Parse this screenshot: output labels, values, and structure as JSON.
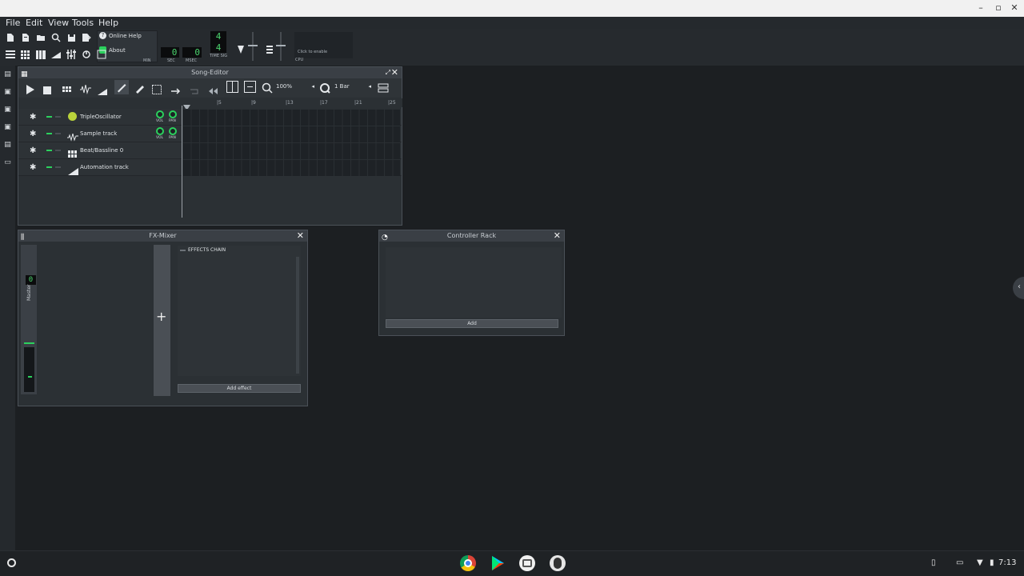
{
  "window": {
    "controls": {
      "minimize": "–",
      "restore": "▫",
      "close": "✕"
    }
  },
  "menu": [
    {
      "label": "File",
      "accel": "F"
    },
    {
      "label": "Edit",
      "accel": "E"
    },
    {
      "label": "View",
      "accel": "V"
    },
    {
      "label": "Tools",
      "accel": "T"
    },
    {
      "label": "Help",
      "accel": "H"
    }
  ],
  "help_menu": {
    "online_help": "Online Help",
    "about": "About"
  },
  "transport": {
    "min": "0",
    "sec": "0",
    "msec": "0",
    "min_label": "MIN",
    "sec_label": "SEC",
    "msec_label": "MSEC",
    "timesig_num": "4",
    "timesig_den": "4",
    "timesig_label": "TIME SIG",
    "cpu_hint": "Click to enable",
    "cpu_label": "CPU"
  },
  "song_editor": {
    "title": "Song-Editor",
    "zoom": "100%",
    "snap": "1 Bar",
    "ruler": [
      "5",
      "9",
      "13",
      "17",
      "21",
      "25"
    ],
    "tracks": [
      {
        "name": "TripleOscillator",
        "icon": "triple-oscillator-icon",
        "knobs": true
      },
      {
        "name": "Sample track",
        "icon": "waveform-icon",
        "knobs": true
      },
      {
        "name": "Beat/Bassline 0",
        "icon": "beat-grid-icon",
        "knobs": false
      },
      {
        "name": "Automation track",
        "icon": "automation-ramp-icon",
        "knobs": false
      }
    ],
    "vol_label": "VOL",
    "pan_label": "PAN"
  },
  "fx_mixer": {
    "title": "FX-Mixer",
    "master_label": "Master",
    "master_value": "0",
    "effects_chain_label": "EFFECTS CHAIN",
    "add_effect_label": "Add effect"
  },
  "controller_rack": {
    "title": "Controller Rack",
    "add_label": "Add"
  },
  "shelf": {
    "time": "7:13",
    "apps": [
      "chrome",
      "play-store",
      "files",
      "linux-terminal"
    ]
  },
  "colors": {
    "accent_green": "#2bd15d",
    "lcd_green": "#4bd46e",
    "bg": "#1c1f22"
  }
}
